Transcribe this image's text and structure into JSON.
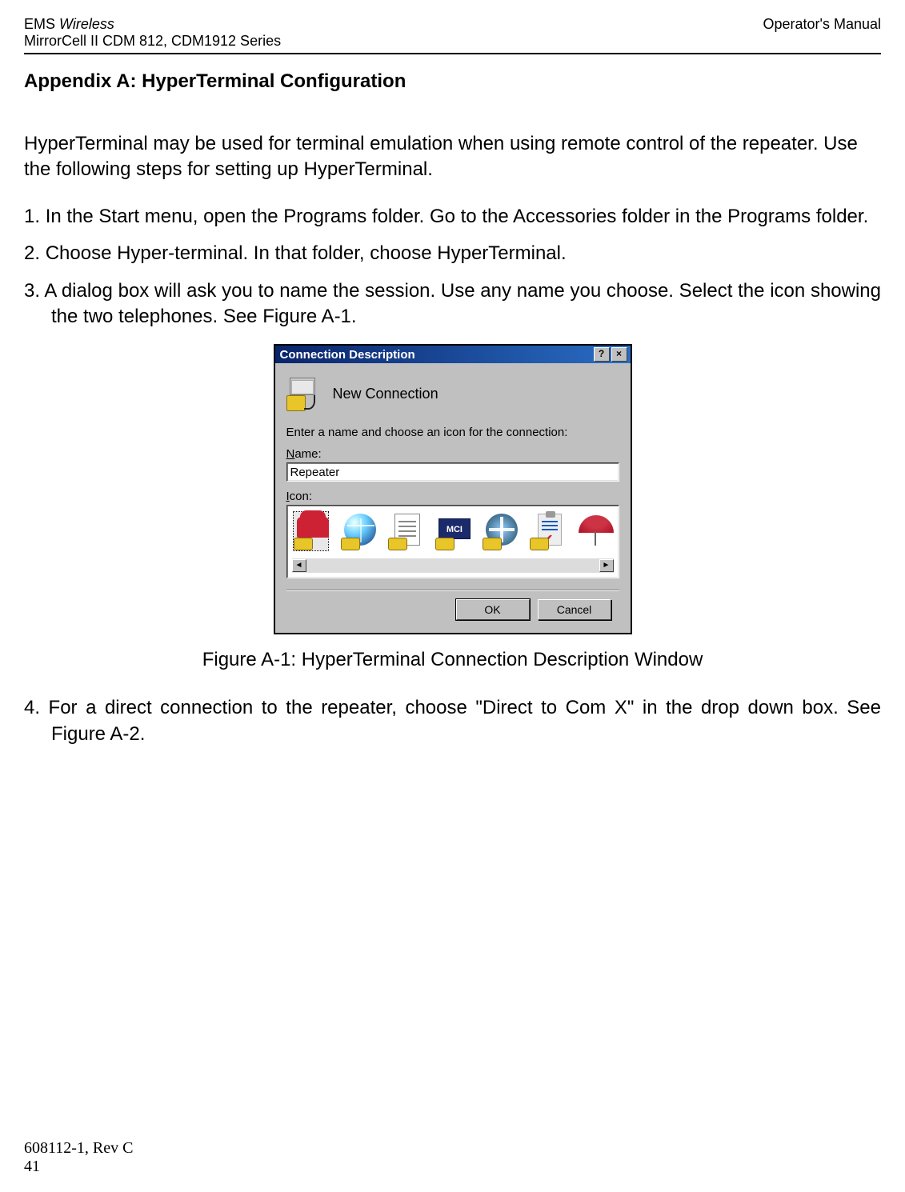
{
  "header": {
    "brand_ems": "EMS ",
    "brand_wireless": "Wireless",
    "product": "MirrorCell II CDM 812, CDM1912 Series",
    "right": "Operator's Manual"
  },
  "appendix_title": "Appendix A:  HyperTerminal Configuration",
  "intro": "HyperTerminal may be used for terminal emulation when using remote control of the repeater. Use the following steps for setting up HyperTerminal.",
  "steps": {
    "s1_num": "1.",
    "s1": "In the Start menu, open the Programs folder. Go to the Accessories folder in the Programs folder.",
    "s2_num": "2.",
    "s2": "Choose Hyper-terminal. In that folder, choose HyperTerminal.",
    "s3_num": "3.",
    "s3": "A dialog box will ask you to name the session. Use any name you choose. Select the icon showing the two telephones. See Figure A-1.",
    "s4_num": "4.",
    "s4": "For a direct connection to the repeater, choose \"Direct to Com X\" in the drop down box. See Figure A-2."
  },
  "dialog": {
    "title": "Connection Description",
    "help_btn": "?",
    "close_btn": "×",
    "new_connection": "New Connection",
    "instruction": "Enter a name and choose an icon for the connection:",
    "name_label_u": "N",
    "name_label_rest": "ame:",
    "name_value": "Repeater",
    "icon_label_u": "I",
    "icon_label_rest": "con:",
    "mci": "MCI",
    "scroll_left": "◄",
    "scroll_right": "►",
    "ok": "OK",
    "cancel": "Cancel"
  },
  "figure_caption": "Figure A-1:  HyperTerminal Connection Description Window",
  "footer": {
    "rev": "608112-1, Rev C",
    "page": "41"
  }
}
